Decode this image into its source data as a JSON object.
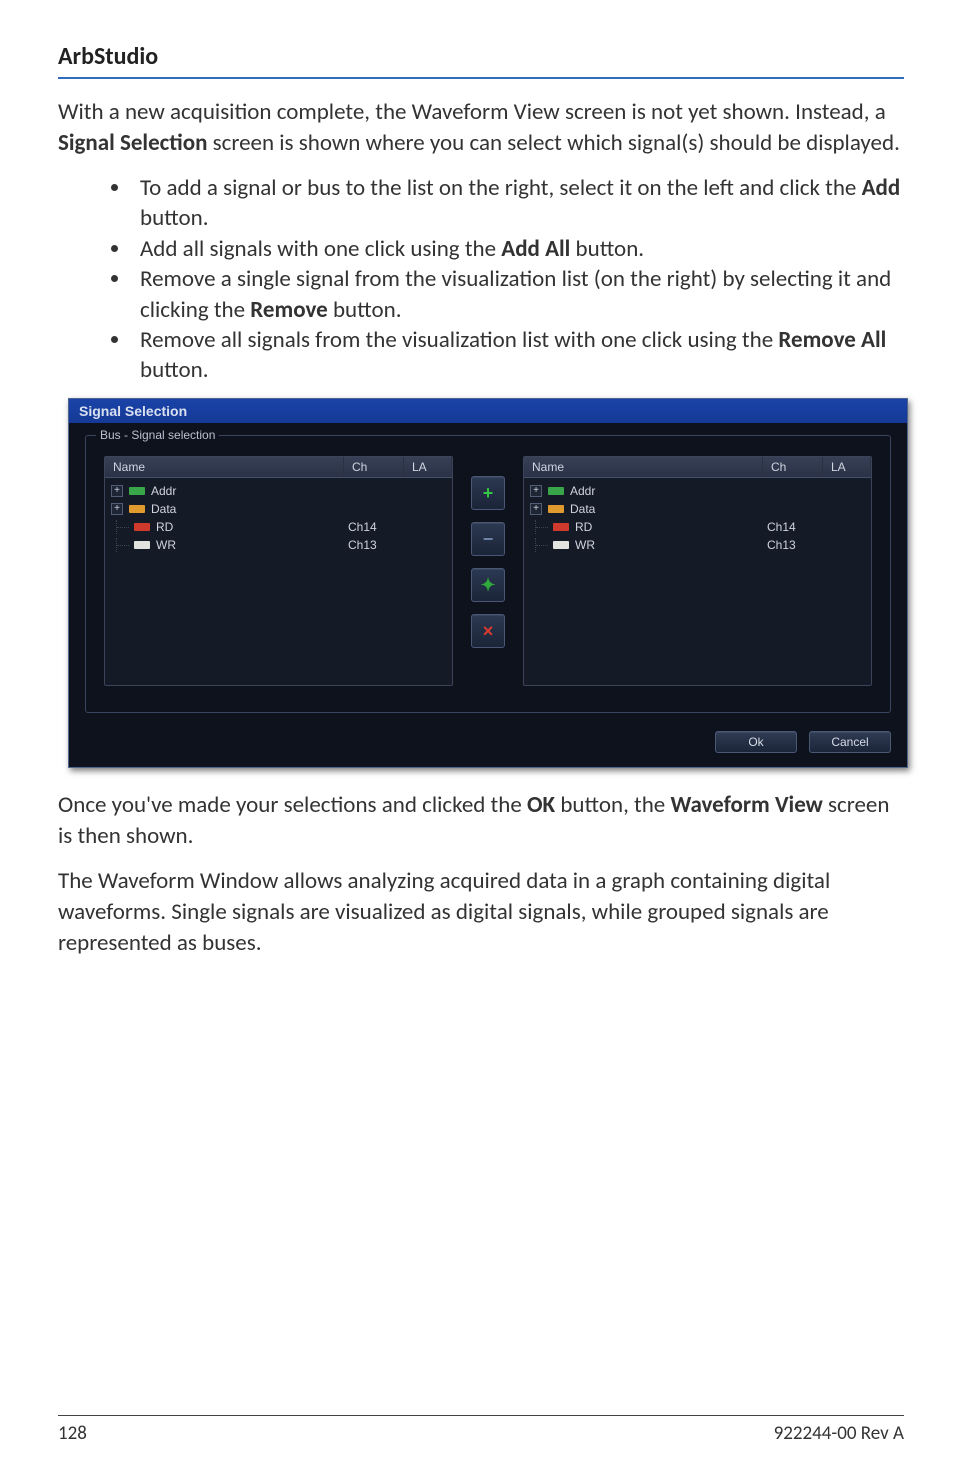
{
  "doc": {
    "header_title": "ArbStudio",
    "para1_pre": "With a new acquisition complete, the Waveform View screen is not yet shown. Instead, a ",
    "para1_bold": "Signal Selection",
    "para1_post": " screen is shown where you can select which signal(s) should be displayed.",
    "bullets": [
      {
        "pre": "To add a signal or bus to the list on the right, select it on the left and click the ",
        "bold": "Add",
        "post": " button."
      },
      {
        "pre": "Add all signals with one click using the ",
        "bold": "Add All",
        "post": " button."
      },
      {
        "pre": "Remove a single signal from the visualization list (on the right) by selecting it and clicking the ",
        "bold": "Remove",
        "post": " button."
      },
      {
        "pre": "Remove all signals from the visualization list with one click using the ",
        "bold": "Remove All",
        "post": " button."
      }
    ],
    "para2_pre": "Once you've made your selections and clicked the ",
    "para2_bold1": "OK",
    "para2_mid": " button, the ",
    "para2_bold2": "Waveform View",
    "para2_post": " screen is then shown.",
    "para3": "The Waveform Window allows analyzing acquired data in a graph containing digital waveforms. Single signals are visualized as digital signals, while grouped signals are represented as buses.",
    "footer_page": "128",
    "footer_doc": "922244-00 Rev A"
  },
  "dialog": {
    "title": "Signal Selection",
    "fieldset_legend": "Bus - Signal selection",
    "headers": {
      "name": "Name",
      "ch": "Ch",
      "la": "LA"
    },
    "left": {
      "rows": [
        {
          "kind": "bus",
          "label": "Addr",
          "swatch": "sw-green"
        },
        {
          "kind": "bus",
          "label": "Data",
          "swatch": "sw-orange"
        },
        {
          "kind": "sig",
          "label": "RD",
          "swatch": "sw-red",
          "ch": "Ch14"
        },
        {
          "kind": "sig",
          "label": "WR",
          "swatch": "sw-white",
          "ch": "Ch13"
        }
      ]
    },
    "right": {
      "rows": [
        {
          "kind": "bus",
          "label": "Addr",
          "swatch": "sw-green"
        },
        {
          "kind": "bus",
          "label": "Data",
          "swatch": "sw-orange"
        },
        {
          "kind": "sig",
          "label": "RD",
          "swatch": "sw-red",
          "ch": "Ch14"
        },
        {
          "kind": "sig",
          "label": "WR",
          "swatch": "sw-white",
          "ch": "Ch13"
        }
      ]
    },
    "buttons": {
      "add": "+",
      "remove": "−",
      "add_all": "✦",
      "remove_all": "×",
      "ok": "Ok",
      "cancel": "Cancel"
    }
  }
}
